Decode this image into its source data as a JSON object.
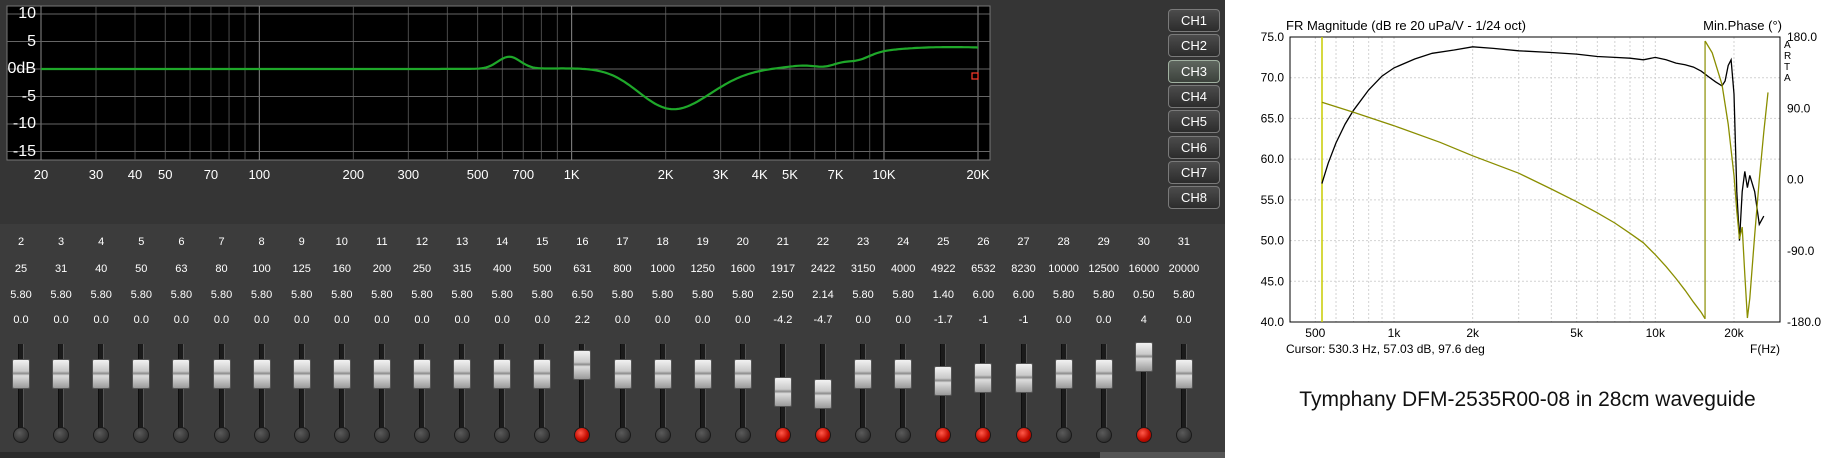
{
  "eq": {
    "y_labels": [
      "10",
      "5",
      "0dB",
      "-5",
      "-10",
      "-15"
    ],
    "y_values": [
      10,
      5,
      0,
      -5,
      -10,
      -15
    ],
    "x_labels": [
      "20",
      "30",
      "40",
      "50",
      "70",
      "100",
      "200",
      "300",
      "500",
      "700",
      "1K",
      "2K",
      "3K",
      "4K",
      "5K",
      "7K",
      "10K",
      "20K"
    ],
    "x_values": [
      20,
      30,
      40,
      50,
      70,
      100,
      200,
      300,
      500,
      700,
      1000,
      2000,
      3000,
      4000,
      5000,
      7000,
      10000,
      20000
    ],
    "curve_color": "#1fa82a",
    "marker_color": "#ff3a2a",
    "channels": [
      "CH1",
      "CH2",
      "CH3",
      "CH4",
      "CH5",
      "CH6",
      "CH7",
      "CH8"
    ],
    "active_channel": "CH3",
    "bands": [
      {
        "num": "2",
        "freq": "25",
        "q": "5.80",
        "gain": "0.0",
        "active": false
      },
      {
        "num": "3",
        "freq": "31",
        "q": "5.80",
        "gain": "0.0",
        "active": false
      },
      {
        "num": "4",
        "freq": "40",
        "q": "5.80",
        "gain": "0.0",
        "active": false
      },
      {
        "num": "5",
        "freq": "50",
        "q": "5.80",
        "gain": "0.0",
        "active": false
      },
      {
        "num": "6",
        "freq": "63",
        "q": "5.80",
        "gain": "0.0",
        "active": false
      },
      {
        "num": "7",
        "freq": "80",
        "q": "5.80",
        "gain": "0.0",
        "active": false
      },
      {
        "num": "8",
        "freq": "100",
        "q": "5.80",
        "gain": "0.0",
        "active": false
      },
      {
        "num": "9",
        "freq": "125",
        "q": "5.80",
        "gain": "0.0",
        "active": false
      },
      {
        "num": "10",
        "freq": "160",
        "q": "5.80",
        "gain": "0.0",
        "active": false
      },
      {
        "num": "11",
        "freq": "200",
        "q": "5.80",
        "gain": "0.0",
        "active": false
      },
      {
        "num": "12",
        "freq": "250",
        "q": "5.80",
        "gain": "0.0",
        "active": false
      },
      {
        "num": "13",
        "freq": "315",
        "q": "5.80",
        "gain": "0.0",
        "active": false
      },
      {
        "num": "14",
        "freq": "400",
        "q": "5.80",
        "gain": "0.0",
        "active": false
      },
      {
        "num": "15",
        "freq": "500",
        "q": "5.80",
        "gain": "0.0",
        "active": false
      },
      {
        "num": "16",
        "freq": "631",
        "q": "6.50",
        "gain": "2.2",
        "active": true
      },
      {
        "num": "17",
        "freq": "800",
        "q": "5.80",
        "gain": "0.0",
        "active": false
      },
      {
        "num": "18",
        "freq": "1000",
        "q": "5.80",
        "gain": "0.0",
        "active": false
      },
      {
        "num": "19",
        "freq": "1250",
        "q": "5.80",
        "gain": "0.0",
        "active": false
      },
      {
        "num": "20",
        "freq": "1600",
        "q": "5.80",
        "gain": "0.0",
        "active": false
      },
      {
        "num": "21",
        "freq": "1917",
        "q": "2.50",
        "gain": "-4.2",
        "active": true
      },
      {
        "num": "22",
        "freq": "2422",
        "q": "2.14",
        "gain": "-4.7",
        "active": true
      },
      {
        "num": "23",
        "freq": "3150",
        "q": "5.80",
        "gain": "0.0",
        "active": false
      },
      {
        "num": "24",
        "freq": "4000",
        "q": "5.80",
        "gain": "0.0",
        "active": false
      },
      {
        "num": "25",
        "freq": "4922",
        "q": "1.40",
        "gain": "-1.7",
        "active": true
      },
      {
        "num": "26",
        "freq": "6532",
        "q": "6.00",
        "gain": "-1",
        "active": true
      },
      {
        "num": "27",
        "freq": "8230",
        "q": "6.00",
        "gain": "-1",
        "active": true
      },
      {
        "num": "28",
        "freq": "10000",
        "q": "5.80",
        "gain": "0.0",
        "active": false
      },
      {
        "num": "29",
        "freq": "12500",
        "q": "5.80",
        "gain": "0.0",
        "active": false
      },
      {
        "num": "30",
        "freq": "16000",
        "q": "0.50",
        "gain": "4",
        "active": true
      },
      {
        "num": "31",
        "freq": "20000",
        "q": "5.80",
        "gain": "0.0",
        "active": false
      }
    ]
  },
  "chart_data": {
    "type": "line",
    "title": "FR Magnitude (dB re 20 uPa/V - 1/24 oct)",
    "right_title": "Min.Phase (°)",
    "brand": [
      "A",
      "R",
      "T",
      "A"
    ],
    "xlabel": "F(Hz)",
    "x_ticks": [
      500,
      1000,
      2000,
      5000,
      10000,
      20000
    ],
    "x_tick_labels": [
      "500",
      "1k",
      "2k",
      "5k",
      "10k",
      "20k"
    ],
    "xlim": [
      400,
      30000
    ],
    "x_scale": "log",
    "ylim": [
      40,
      75
    ],
    "y_ticks": [
      "75.0",
      "70.0",
      "65.0",
      "60.0",
      "55.0",
      "50.0",
      "45.0",
      "40.0"
    ],
    "y_right_lim": [
      -180,
      180
    ],
    "y_right_ticks": [
      "180.0",
      "90.0",
      "0.0",
      "-90.0",
      "-180.0"
    ],
    "cursor": "Cursor: 530.3 Hz, 57.03 dB, 97.6 deg",
    "cursor_freq": 530.3,
    "series": [
      {
        "color": "#000000",
        "axis": "left",
        "x": [
          530,
          560,
          600,
          650,
          700,
          800,
          900,
          1000,
          1200,
          1400,
          1700,
          2000,
          2400,
          3000,
          4000,
          5000,
          6000,
          7000,
          8000,
          9000,
          10000,
          11000,
          12000,
          13000,
          14000,
          15000,
          16000,
          17000,
          18000,
          18500,
          19000,
          19500,
          20000,
          20500,
          21000,
          21500,
          22000,
          22500,
          23000,
          24000,
          25000,
          26000
        ],
        "y": [
          57,
          59.5,
          62,
          64.3,
          66,
          68.5,
          70.2,
          71.2,
          72.3,
          73,
          73.4,
          73.8,
          73.6,
          73.3,
          73.1,
          72.9,
          72.6,
          72.5,
          72.4,
          72.2,
          72.5,
          72.2,
          71.8,
          71.6,
          71.3,
          70.8,
          70.1,
          69.5,
          69.0,
          69.6,
          71.5,
          72.2,
          68.0,
          56.0,
          50.0,
          56.0,
          58.5,
          56.5,
          58.0,
          56.0,
          52.0,
          53.0
        ]
      },
      {
        "color": "#8a8e00",
        "axis": "right",
        "x": [
          530,
          700,
          1000,
          1500,
          2000,
          3000,
          4000,
          5000,
          6000,
          7000,
          8000,
          9000,
          10000,
          11000,
          12000,
          13000,
          14000,
          15000,
          15500,
          15500,
          16500,
          18000,
          19000,
          20000,
          20500,
          21000,
          21500,
          22000,
          22500,
          23000,
          24000,
          25000,
          26000,
          27000
        ],
        "y": [
          97.6,
          85,
          68,
          47,
          30,
          8,
          -12,
          -28,
          -42,
          -55,
          -68,
          -80,
          -95,
          -110,
          -125,
          -140,
          -155,
          -168,
          -176,
          175,
          160,
          120,
          70,
          5,
          -40,
          -75,
          -60,
          -120,
          -175,
          -150,
          -70,
          0,
          60,
          110
        ]
      }
    ]
  },
  "caption": "Tymphany DFM-2535R00-08 in 28cm waveguide"
}
